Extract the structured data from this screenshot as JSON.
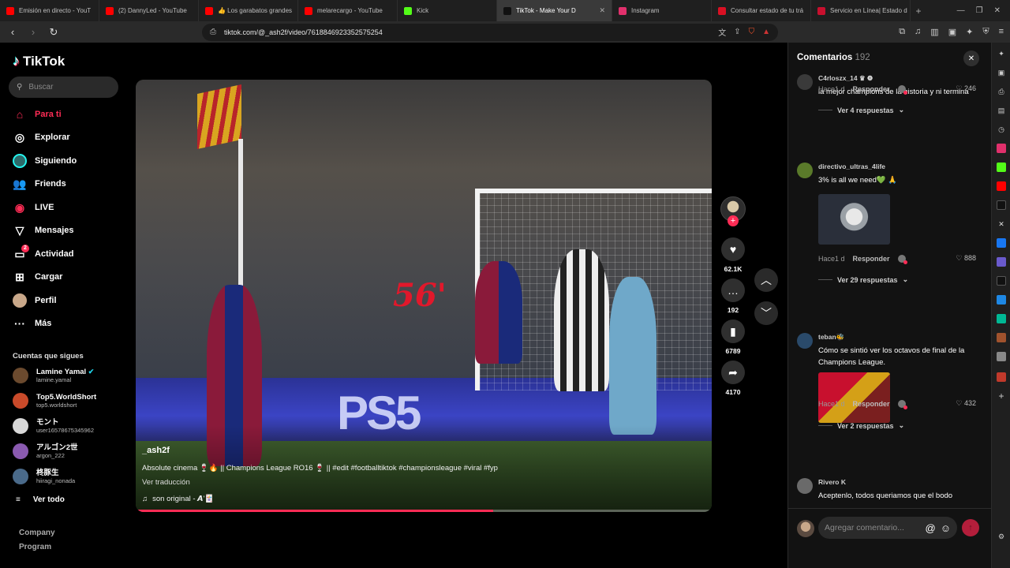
{
  "browser": {
    "tabs": [
      {
        "label": "Emisión en directo - YouT",
        "color": "#ff0000",
        "active": false
      },
      {
        "label": "(2) DannyLed - YouTube",
        "color": "#ff0000",
        "active": false
      },
      {
        "label": "👍 Los garabatos grandes",
        "color": "#ff0000",
        "active": false
      },
      {
        "label": "melarecargo - YouTube",
        "color": "#ff0000",
        "active": false
      },
      {
        "label": "Kick",
        "color": "#53fc18",
        "active": false
      },
      {
        "label": "TikTok - Make Your D",
        "color": "#111111",
        "active": true
      },
      {
        "label": "Instagram",
        "color": "#e1306c",
        "active": false
      },
      {
        "label": "Consultar estado de tu trá",
        "color": "#d91023",
        "active": false
      },
      {
        "label": "Servicio en Línea| Estado d",
        "color": "#c8102e",
        "active": false
      }
    ],
    "url": "tiktok.com/@_ash2f/video/7618846923352575254"
  },
  "sidebar": {
    "logo": "TikTok",
    "search_placeholder": "Buscar",
    "nav": [
      {
        "label": "Para ti",
        "icon": "home-icon",
        "glyph": "⌂",
        "active": true
      },
      {
        "label": "Explorar",
        "icon": "compass-icon",
        "glyph": "◎",
        "active": false
      },
      {
        "label": "Siguiendo",
        "icon": "following-avatar-icon",
        "glyph": "●",
        "active": false
      },
      {
        "label": "Friends",
        "icon": "friends-icon",
        "glyph": "👥",
        "active": false
      },
      {
        "label": "LIVE",
        "icon": "live-icon",
        "glyph": "◉",
        "active": false
      },
      {
        "label": "Mensajes",
        "icon": "paper-plane-icon",
        "glyph": "▽",
        "active": false
      },
      {
        "label": "Actividad",
        "icon": "activity-icon",
        "glyph": "▭",
        "active": false,
        "badge": "2"
      },
      {
        "label": "Cargar",
        "icon": "upload-icon",
        "glyph": "⊞",
        "active": false
      },
      {
        "label": "Perfil",
        "icon": "profile-avatar-icon",
        "glyph": "●",
        "active": false
      },
      {
        "label": "Más",
        "icon": "more-icon",
        "glyph": "···",
        "active": false
      }
    ],
    "following_title": "Cuentas que sigues",
    "accounts": [
      {
        "name": "Lamine Yamal",
        "handle": "lamine.yamal",
        "verified": true,
        "color": "#6b4a2e"
      },
      {
        "name": "Top5.WorldShort",
        "handle": "top5.worldshort",
        "verified": false,
        "color": "#c94a2a"
      },
      {
        "name": "モント",
        "handle": "user16578675345962",
        "verified": false,
        "color": "#d8d8d8"
      },
      {
        "name": "アルゴン2世",
        "handle": "argon_222",
        "verified": false,
        "color": "#8a5ab0"
      },
      {
        "name": "柊豚生",
        "handle": "hiiragi_nonada",
        "verified": false,
        "color": "#4a6a8a"
      }
    ],
    "see_all": "Ver todo",
    "see_all_icon": "≡",
    "company": "Company",
    "program": "Program"
  },
  "video": {
    "overlay_minute": "56'",
    "author": "_ash2f",
    "caption": "Absolute cinema 🍷🔥 || Champions League RO16 🍷 || #edit #footballtiktok #championsleague #viral #fyp",
    "translate": "Ver traducción",
    "sound": "son original - 𝘼'🃏",
    "progress": 0.62
  },
  "actions": {
    "likes": "62.1K",
    "comments": "192",
    "saves": "6789",
    "shares": "4170"
  },
  "comments": {
    "title": "Comentarios",
    "count": "192",
    "items": [
      {
        "user": "C4rloszx_14 ♛ ❁",
        "text": "la mejor champions de la historia y ni termina",
        "time": "Hace1 d",
        "reply": "Responder",
        "likes": "246",
        "more": "Ver 4 respuestas",
        "avatar": "#3a3a3a",
        "has_image": false
      },
      {
        "user": "directivo_ultras_4life",
        "text": "3% is all we need💚 🙏",
        "time": "Hace1 d",
        "reply": "Responder",
        "likes": "888",
        "more": "Ver 29 respuestas",
        "avatar": "#5a7a2a",
        "has_image": true
      },
      {
        "user": "teban🐝",
        "text": "Cómo se sintió ver los octavos de final de la Champions League.",
        "time": "Hace1 d",
        "reply": "Responder",
        "likes": "432",
        "more": "Ver 2 respuestas",
        "avatar": "#2a4a6a",
        "has_image": true
      },
      {
        "user": "Rivero K",
        "text": "Aceptenlo, todos queriamos que el bodo",
        "avatar": "#6a6a6a"
      }
    ],
    "input_placeholder": "Agregar comentario..."
  }
}
